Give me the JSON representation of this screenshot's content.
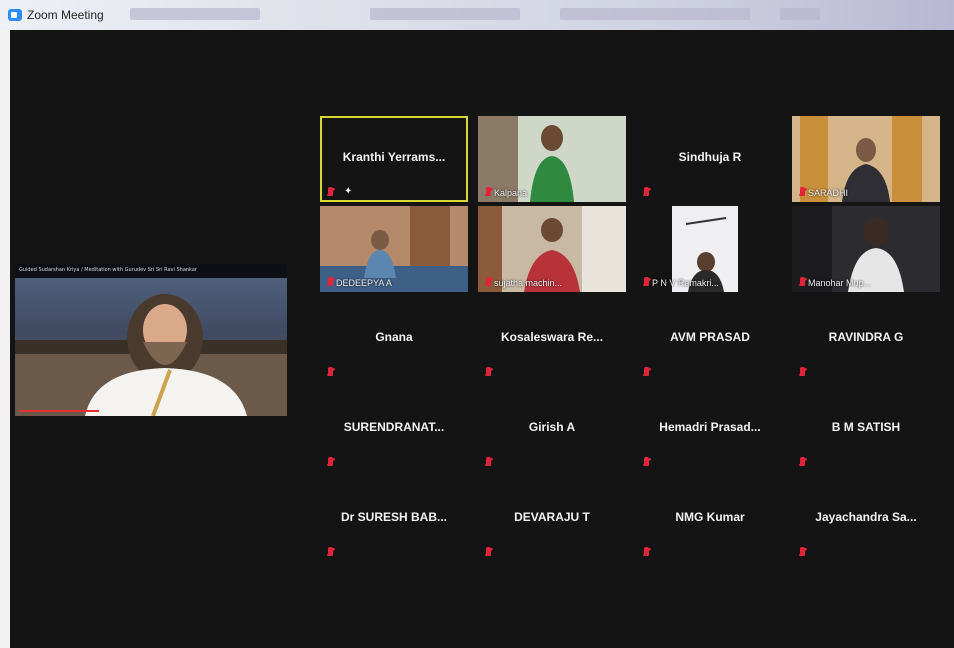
{
  "window": {
    "title": "Zoom Meeting"
  },
  "screen_share": {
    "caption": "Guided Sudarshan Kriya / Meditation with Gurudev Sri Sri Ravi Shankar"
  },
  "participants": [
    {
      "name": "Kranthi Yerrams...",
      "video": false,
      "active": true,
      "pinned": true
    },
    {
      "name": "Kalpana",
      "video": true
    },
    {
      "name": "Sindhuja R",
      "video": false
    },
    {
      "name": "SARADHI",
      "video": true
    },
    {
      "name": "DEDEEPYA A",
      "video": true
    },
    {
      "name": "sujatha machin...",
      "video": true
    },
    {
      "name": "P N V Ramakri...",
      "video": true
    },
    {
      "name": "Manohar Mup...",
      "video": true
    },
    {
      "name": "Gnana",
      "video": false
    },
    {
      "name": "Kosaleswara Re...",
      "video": false
    },
    {
      "name": "AVM PRASAD",
      "video": false
    },
    {
      "name": "RAVINDRA G",
      "video": false
    },
    {
      "name": "SURENDRANAT...",
      "video": false
    },
    {
      "name": "Girish A",
      "video": false
    },
    {
      "name": "Hemadri Prasad...",
      "video": false
    },
    {
      "name": "B M SATISH",
      "video": false
    },
    {
      "name": "Dr SURESH BAB...",
      "video": false
    },
    {
      "name": "DEVARAJU T",
      "video": false
    },
    {
      "name": "NMG Kumar",
      "video": false
    },
    {
      "name": "Jayachandra Sa...",
      "video": false
    }
  ],
  "colors": {
    "active_speaker": "#d7d931",
    "muted": "#e0243a",
    "background": "#141414"
  }
}
